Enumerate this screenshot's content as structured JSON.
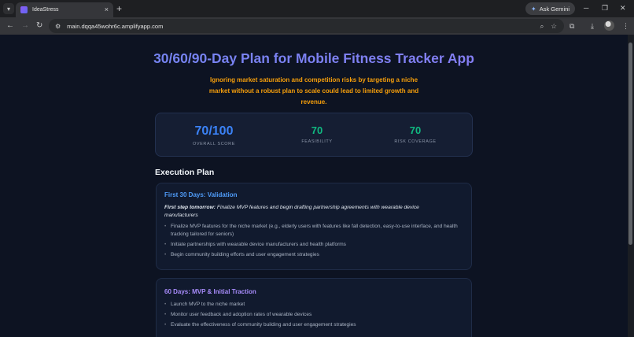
{
  "browser": {
    "tab_title": "IdeaStress",
    "url": "main.dqqa45wohr6c.amplifyapp.com",
    "gemini_label": "Ask Gemini"
  },
  "page": {
    "title": "30/60/90-Day Plan for Mobile Fitness Tracker App",
    "warning": "Ignoring market saturation and competition risks by targeting a niche market without a robust plan to scale could lead to limited growth and revenue.",
    "scores": {
      "overall_value": "70/100",
      "overall_label": "OVERALL SCORE",
      "feasibility_value": "70",
      "feasibility_label": "FEASIBILITY",
      "risk_value": "70",
      "risk_label": "RISK COVERAGE"
    },
    "execution_title": "Execution Plan",
    "phases": [
      {
        "title": "First 30 Days: Validation",
        "first_step_label": "First step tomorrow:",
        "first_step_text": " Finalize MVP features and begin drafting partnership agreements with wearable device manufacturers",
        "tasks": [
          "Finalize MVP features for the niche market (e.g., elderly users with features like fall detection, easy-to-use interface, and health tracking tailored for seniors)",
          "Initiate partnerships with wearable device manufacturers and health platforms",
          "Begin community building efforts and user engagement strategies"
        ]
      },
      {
        "title": "60 Days: MVP & Initial Traction",
        "tasks": [
          "Launch MVP to the niche market",
          "Monitor user feedback and adoption rates of wearable devices",
          "Evaluate the effectiveness of community building and user engagement strategies"
        ]
      }
    ]
  },
  "colors": {
    "background": "#0d1322",
    "title_gradient_start": "#6e86f0",
    "title_gradient_end": "#8b7cf5",
    "warning": "#f59e0b",
    "score_main": "#3b82f6",
    "score_secondary": "#10b981",
    "phase1_title": "#4f9cf9",
    "phase2_title": "#a78bfa"
  }
}
